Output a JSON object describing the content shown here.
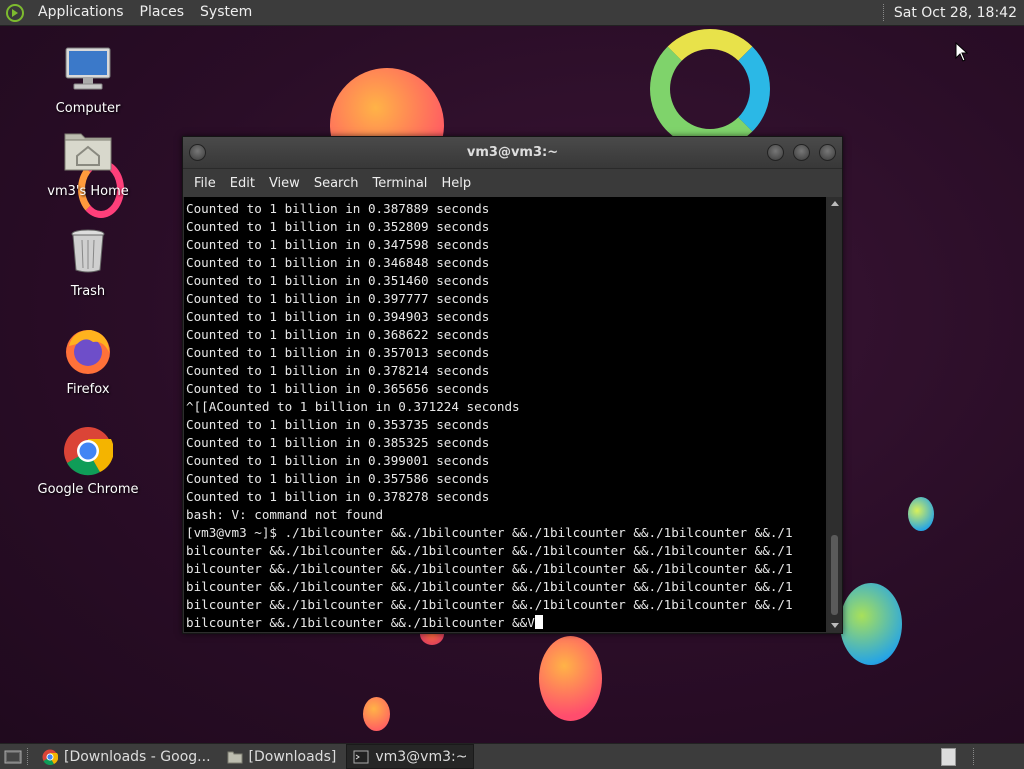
{
  "top_panel": {
    "menu": [
      "Applications",
      "Places",
      "System"
    ],
    "clock": "Sat Oct 28, 18:42"
  },
  "desktop_icons": [
    {
      "label": "Computer",
      "icon": "computer-icon"
    },
    {
      "label": "vm3's Home",
      "icon": "home-folder-icon"
    },
    {
      "label": "Trash",
      "icon": "trash-icon"
    },
    {
      "label": "Firefox",
      "icon": "firefox-icon"
    },
    {
      "label": "Google Chrome",
      "icon": "chrome-icon"
    }
  ],
  "terminal": {
    "title": "vm3@vm3:~",
    "menu": [
      "File",
      "Edit",
      "View",
      "Search",
      "Terminal",
      "Help"
    ],
    "lines": [
      "Counted to 1 billion in 0.387889 seconds",
      "Counted to 1 billion in 0.352809 seconds",
      "Counted to 1 billion in 0.347598 seconds",
      "Counted to 1 billion in 0.346848 seconds",
      "Counted to 1 billion in 0.351460 seconds",
      "Counted to 1 billion in 0.397777 seconds",
      "Counted to 1 billion in 0.394903 seconds",
      "Counted to 1 billion in 0.368622 seconds",
      "Counted to 1 billion in 0.357013 seconds",
      "Counted to 1 billion in 0.378214 seconds",
      "Counted to 1 billion in 0.365656 seconds",
      "^[[ACounted to 1 billion in 0.371224 seconds",
      "Counted to 1 billion in 0.353735 seconds",
      "Counted to 1 billion in 0.385325 seconds",
      "Counted to 1 billion in 0.399001 seconds",
      "Counted to 1 billion in 0.357586 seconds",
      "Counted to 1 billion in 0.378278 seconds",
      "bash: V: command not found",
      "[vm3@vm3 ~]$ ./1bilcounter &&./1bilcounter &&./1bilcounter &&./1bilcounter &&./1",
      "bilcounter &&./1bilcounter &&./1bilcounter &&./1bilcounter &&./1bilcounter &&./1",
      "bilcounter &&./1bilcounter &&./1bilcounter &&./1bilcounter &&./1bilcounter &&./1",
      "bilcounter &&./1bilcounter &&./1bilcounter &&./1bilcounter &&./1bilcounter &&./1",
      "bilcounter &&./1bilcounter &&./1bilcounter &&./1bilcounter &&./1bilcounter &&./1"
    ],
    "prompt_line": "bilcounter &&./1bilcounter &&./1bilcounter &&V"
  },
  "taskbar": {
    "tasks": [
      {
        "label": "[Downloads - Goog...",
        "icon": "chrome-icon"
      },
      {
        "label": "[Downloads]",
        "icon": "folder-icon"
      },
      {
        "label": "vm3@vm3:~",
        "icon": "terminal-icon"
      }
    ]
  },
  "colors": {
    "panel_bg": "#3c3c3c",
    "terminal_bg": "#000000",
    "desktop_bg": "#2d0f2b"
  }
}
